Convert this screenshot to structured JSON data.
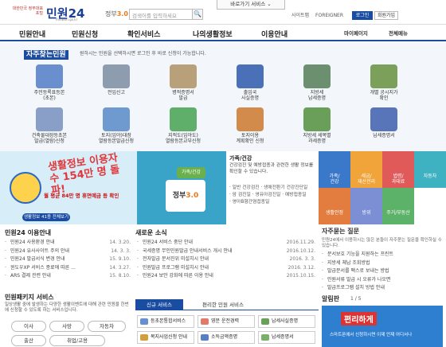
{
  "header": {
    "emblem_text": "대한민국 정부대표포털",
    "brand": "민원24",
    "brand_sub": "minwon.go.kr",
    "gov30": "정부",
    "gov30_num": "3.0",
    "search_placeholder": "검색어를 입력하세요",
    "search_btn": "🔍",
    "quick_menu": "바로가기 서비스 ⌄",
    "links": [
      "사이트맵",
      "FOREIGNER"
    ],
    "login": "로그인",
    "join": "회원가입"
  },
  "nav": {
    "items": [
      "민원안내",
      "민원신청",
      "확인서비스",
      "나의생활정보",
      "이용안내"
    ],
    "mypage": "마이페이지",
    "allmenu": "전체메뉴"
  },
  "quick_services": {
    "title": "자주찾는민원",
    "desc": "원하시는 민원을 선택하시면 로그인 후 바로 신청이 가능합니다.",
    "items": [
      {
        "label": "주민등록표등본\n(초본)",
        "color": "#6a8fcf"
      },
      {
        "label": "전입신고",
        "color": "#8e9cb0"
      },
      {
        "label": "병적증명서\n발급",
        "color": "#b8a07a"
      },
      {
        "label": "출입국\n사실증명",
        "color": "#4a70b8"
      },
      {
        "label": "지방세\n납세증명",
        "color": "#6b8f6f"
      },
      {
        "label": "개별 공시지가\n확인",
        "color": "#7aa05a"
      },
      {
        "label": "건축물대장등초본\n발급(열람)신청",
        "color": "#8a9fc7"
      },
      {
        "label": "토지(임야)대장\n열람등본발급신청",
        "color": "#6f9ad0"
      },
      {
        "label": "지적도(임야도)\n열람등본교부신청",
        "color": "#5fae6a"
      },
      {
        "label": "토지이용\n계획확인 신청",
        "color": "#d28b4a"
      },
      {
        "label": "지방세 세목별\n과세증명",
        "color": "#6a9f5a"
      },
      {
        "label": "납세증명서",
        "color": "#5775b8"
      }
    ]
  },
  "banner": {
    "headline": "생활정보 이용자수 154만 명 돌파!",
    "sub": "월 평균 84만 명 휴면예금 등 확인",
    "pill": "생활정보 41종 전체보기",
    "gov_box": "정부",
    "gov_box_num": "3.0",
    "tag": "가족/건강",
    "right_title": "가족/건강",
    "right_text": "건강검진 및 예방접종과 관련한 생활 정보를 확인할 수 있습니다.",
    "right_list": [
      "· 일반 건강검진 · 생애전환기 건강진단일",
      "· 암 검진일 · 영유아검진일 · 예방접종일",
      "· 영아B형간염접종일"
    ]
  },
  "tiles": [
    {
      "label": "가족/\n건강",
      "color": "#3a78c9"
    },
    {
      "label": "세금/\n재산관리",
      "color": "#f0a43a"
    },
    {
      "label": "법령/\n과태료",
      "color": "#e05a5a"
    },
    {
      "label": "자동차",
      "color": "#3fb2c2"
    },
    {
      "label": "생활안정",
      "color": "#e27d3f"
    },
    {
      "label": "방위",
      "color": "#7d8fd4"
    },
    {
      "label": "주거/부동산",
      "color": "#5db26a"
    }
  ],
  "pkg": {
    "title": "민원24 이용안내",
    "items": [
      {
        "t": "민원24 사용환경 안내",
        "d": "14. 3.20."
      },
      {
        "t": "민원24 유사사이트 주의 안내",
        "d": "14. 3. 3."
      },
      {
        "t": "민원24 발급서식 변경 안내",
        "d": "15. 9.10."
      },
      {
        "t": "윈도우XP 서비스 종료에 따른 ...",
        "d": "14. 3.27."
      },
      {
        "t": "ARS 결제 관련 안내",
        "d": "15. 8.10."
      }
    ]
  },
  "pkg2": {
    "title": "민원패키지 서비스",
    "desc": "일상생활 중에 발생하는 다양한 생활이벤트에 대해 관련 민원을 한번에 신청할 수 있도록 하는 서비스입니다.",
    "btns": [
      "이사",
      "사망",
      "자동차",
      "출산",
      "취업/고용"
    ]
  },
  "news": {
    "title": "새로운 소식",
    "items": [
      {
        "t": "민원24 서비스 중단 안내",
        "d": "2016.11.29."
      },
      {
        "t": "국세증명 무인민원발급 안내서비스 개시 안내",
        "d": "2016.10.12."
      },
      {
        "t": "전자발급 문서진위 미설치시 안내",
        "d": "2016. 3. 3."
      },
      {
        "t": "민원발급 프로그램 미설치시 안내",
        "d": "2016. 3.12."
      },
      {
        "t": "민원24 보안 강화에 따른 이용 안내",
        "d": "2015.10.15."
      }
    ]
  },
  "svc_tabs": {
    "tab1": "신규 서비스",
    "tab2": "편리한 민원 서비스",
    "btns": [
      "등초본통합서비스",
      "영문 운전경력",
      "납세사실증명",
      "복지사업신청 안내",
      "소득금액증명",
      "납세증명서"
    ]
  },
  "faq": {
    "title": "자주묻는 질문",
    "desc": "민원24에서 이용하시는 많은 분들이 자주묻는 질문을 확인하실 수 있습니다.",
    "items": [
      "문서보호 기능을 지원하는 프린트",
      "지방세 체납 조회방법",
      "발급문서를 팩스로 보내는 방법",
      "민원서류 발급 시 오류가 나오면",
      "발급프로그램 설치 방법 안내"
    ]
  },
  "alarm": {
    "title": "알림판",
    "page": "1 / 5",
    "ad_text": "편리하게",
    "ad_sub": "스마트폰에서 신청하시면 이제 언제 어디서나"
  }
}
